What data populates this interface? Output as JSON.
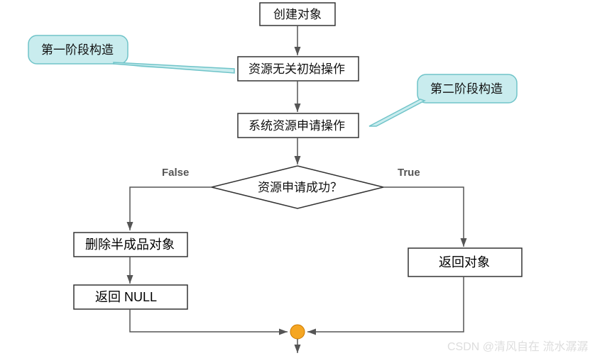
{
  "diagram": {
    "nodes": {
      "create": "创建对象",
      "initNoResource": "资源无关初始操作",
      "allocResource": "系统资源申请操作",
      "decision": "资源申请成功？",
      "deletePartial": "删除半成品对象",
      "returnNull": "返回 NULL",
      "returnObject": "返回对象"
    },
    "callouts": {
      "phase1": "第一阶段构造",
      "phase2": "第二阶段构造"
    },
    "edgeLabels": {
      "falseLabel": "False",
      "trueLabel": "True"
    },
    "watermark": "CSDN @清风自在 流水潺潺"
  }
}
